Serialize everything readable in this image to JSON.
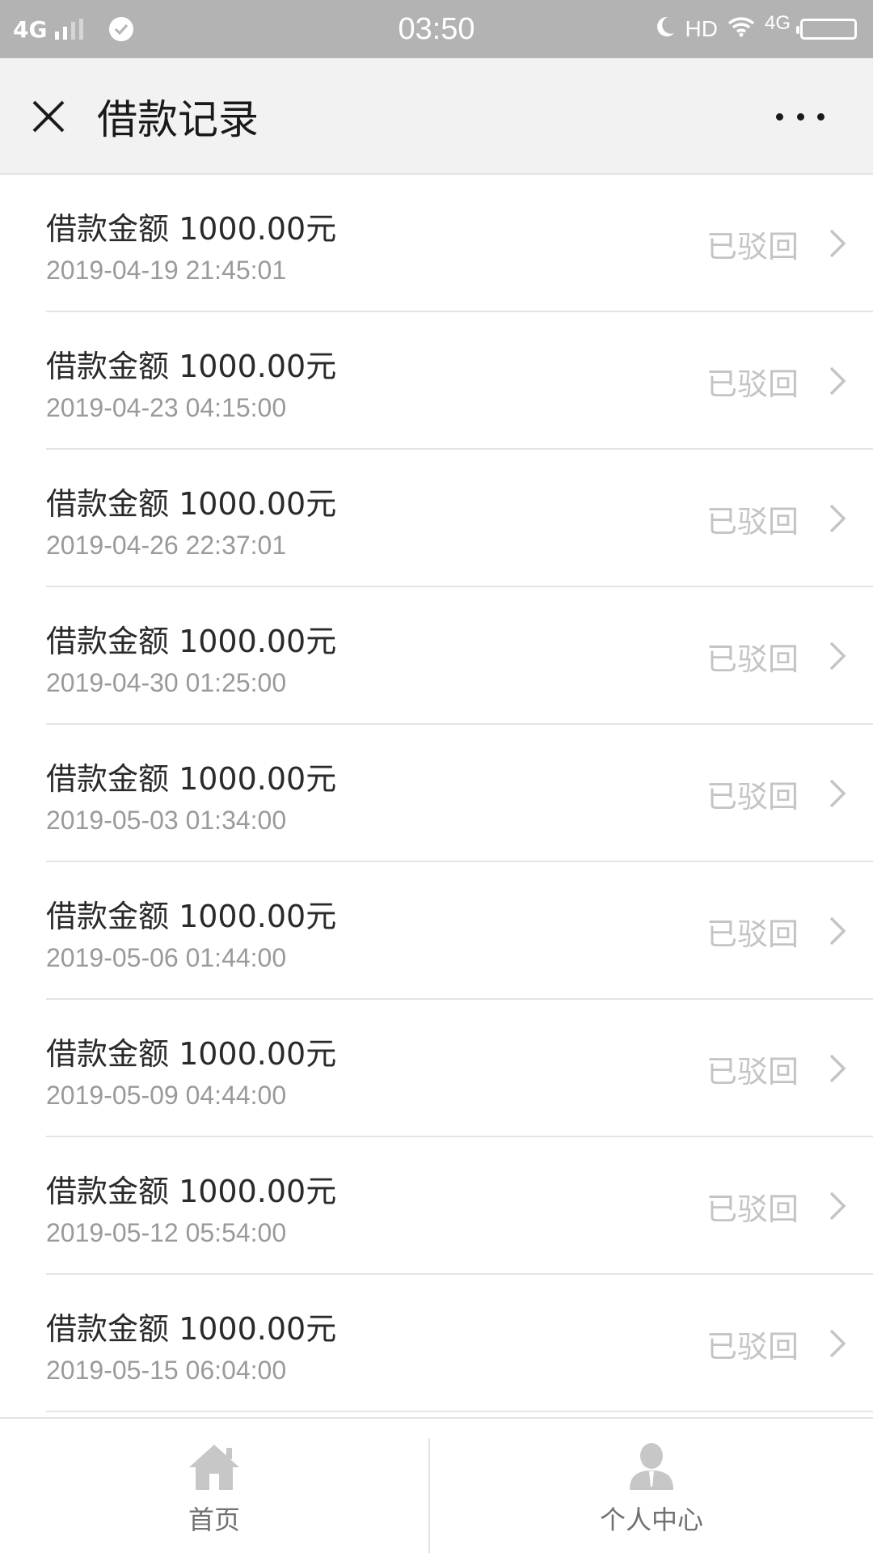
{
  "status_bar": {
    "network_left": "4G",
    "time": "03:50",
    "network_right_hd": "HD",
    "network_right_4g": "4G"
  },
  "nav": {
    "title": "借款记录",
    "close_icon": "close-icon",
    "more_icon": "more-icon"
  },
  "records": [
    {
      "amount": "借款金额 1000.00元",
      "time": "2019-04-19 21:45:01",
      "status": "已驳回"
    },
    {
      "amount": "借款金额 1000.00元",
      "time": "2019-04-23 04:15:00",
      "status": "已驳回"
    },
    {
      "amount": "借款金额 1000.00元",
      "time": "2019-04-26 22:37:01",
      "status": "已驳回"
    },
    {
      "amount": "借款金额 1000.00元",
      "time": "2019-04-30 01:25:00",
      "status": "已驳回"
    },
    {
      "amount": "借款金额 1000.00元",
      "time": "2019-05-03 01:34:00",
      "status": "已驳回"
    },
    {
      "amount": "借款金额 1000.00元",
      "time": "2019-05-06 01:44:00",
      "status": "已驳回"
    },
    {
      "amount": "借款金额 1000.00元",
      "time": "2019-05-09 04:44:00",
      "status": "已驳回"
    },
    {
      "amount": "借款金额 1000.00元",
      "time": "2019-05-12 05:54:00",
      "status": "已驳回"
    },
    {
      "amount": "借款金额 1000.00元",
      "time": "2019-05-15 06:04:00",
      "status": "已驳回"
    }
  ],
  "tab_bar": {
    "home": {
      "label": "首页",
      "icon": "home-icon"
    },
    "user": {
      "label": "个人中心",
      "icon": "user-icon"
    }
  },
  "colors": {
    "status_bar_bg": "#b3b3b3",
    "nav_bg": "#f2f2f2",
    "status_text": "#c4c4c4",
    "time_text": "#9a9a9a"
  }
}
